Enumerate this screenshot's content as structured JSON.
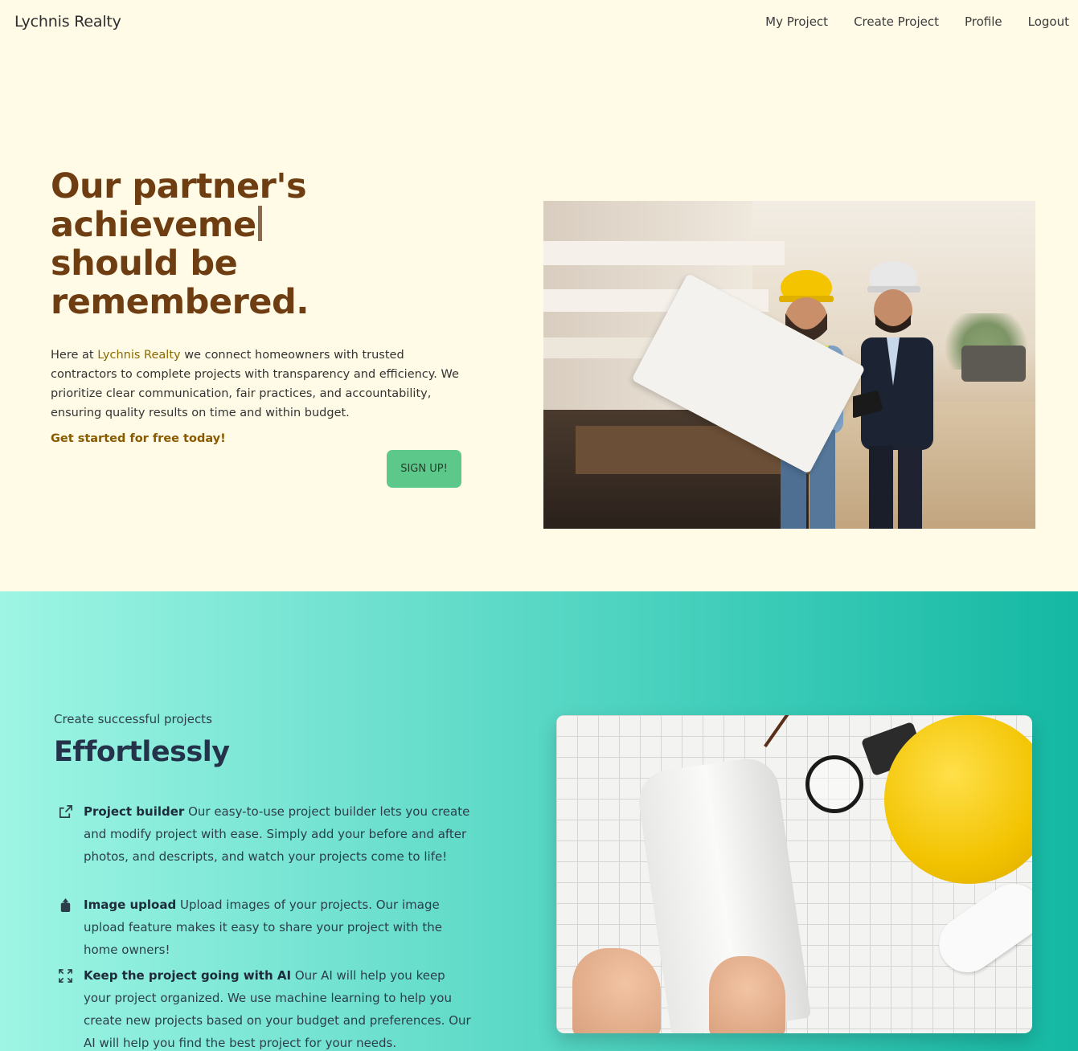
{
  "nav": {
    "brand": "Lychnis Realty",
    "links": [
      "My Project",
      "Create Project",
      "Profile",
      "Logout"
    ]
  },
  "hero": {
    "title_line1": "Our partner's",
    "title_line2": "achieveme",
    "title_line3": "should be",
    "title_line4": "remembered.",
    "intro_prefix": "Here at ",
    "intro_brand": "Lychnis Realty",
    "intro_rest": " we connect homeowners with trusted contractors to complete projects with transparency and efficiency. We prioritize clear communication, fair practices, and accountability, ensuring quality results on time and within budget.",
    "cta_text": "Get started for free today!",
    "signup_label": "SIGN UP!"
  },
  "features": {
    "kicker": "Create successful projects",
    "title": "Effortlessly",
    "items": [
      {
        "icon": "external-link-icon",
        "title": "Project builder",
        "text": " Our easy-to-use project builder lets you create and modify project with ease. Simply add your before and after photos, and descripts, and watch your projects come to life!"
      },
      {
        "icon": "upload-icon",
        "title": "Image upload",
        "text": " Upload images of your projects. Our image upload feature makes it easy to share your project with the home owners!"
      },
      {
        "icon": "expand-icon",
        "title": "Keep the project going with AI",
        "text": " Our AI will help you keep your project organized. We use machine learning to help you create new projects based on your budget and preferences. Our AI will help you find the best project for your needs."
      }
    ]
  },
  "colors": {
    "hero_bg": "#fffbe6",
    "title_brown": "#6f3d12",
    "accent_gold": "#8a6a00",
    "signup_green": "#5cc98a",
    "teal_start": "#9ef5e4",
    "teal_end": "#14b8a3"
  }
}
